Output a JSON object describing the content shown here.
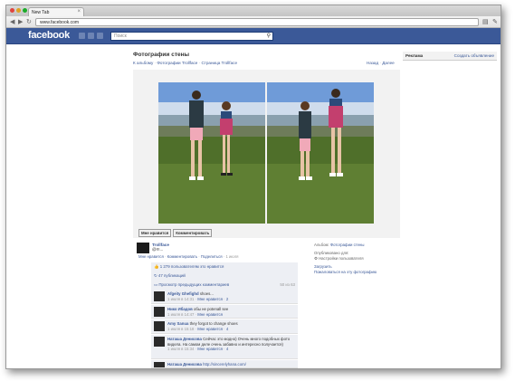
{
  "browser": {
    "tab_title": "New Tab",
    "url": "www.facebook.com"
  },
  "fb": {
    "logo": "facebook",
    "search_placeholder": "Поиск"
  },
  "page": {
    "title": "Фотографии стены",
    "breadcrumbs": [
      "К альбому",
      "Фотографии Trollface",
      "Страница Trollface"
    ],
    "pager_prev": "Назад",
    "pager_next": "Далее"
  },
  "ads": {
    "title": "Реклама",
    "create": "Создать объявление"
  },
  "actions": {
    "like": "Мне нравится",
    "comment": "Комментировать"
  },
  "post": {
    "author": "Trollface",
    "text": "@!!!...",
    "meta_like": "Мне нравится",
    "meta_comment": "Комментировать",
    "meta_share": "Поделиться",
    "meta_time": "1 июля",
    "likes": "1 279 пользователям это нравится",
    "shares": "47 публикаций",
    "prev_comments": "Просмотр предыдущих комментариев",
    "prev_count": "50 из 63"
  },
  "comments": [
    {
      "name": "Afgeity Ghefighd",
      "text": "shoes...",
      "meta": "1 июля в 14:31",
      "like": "Мне нравится",
      "count": "2"
    },
    {
      "name": "Нико Ибадов",
      "text": "обы не potenall see",
      "meta": "1 июля в 14:47",
      "like": "Мне нравится",
      "count": ""
    },
    {
      "name": "Amy Sanua",
      "text": "they forgot to change shoes",
      "meta": "1 июля в 15:18",
      "like": "Мне нравится",
      "count": "4"
    },
    {
      "name": "Наташа Денисова",
      "text": "Сейчас это модно) Очень много подобных фото видела. На самом деле очень забавно и интересно получается)",
      "meta": "1 июля в 15:34",
      "like": "Мне нравится",
      "count": "4"
    },
    {
      "name": "Наташа Денисова",
      "text": "http://sincerelyhana.com/",
      "meta": "",
      "like": "",
      "count": ""
    }
  ],
  "album": {
    "album_label": "Альбом:",
    "album_link": "Фотографии стены",
    "published_label": "Опубликовано для:",
    "privacy": "Настройки пользователя",
    "download": "Загрузить",
    "report": "Пожаловаться на эту фотографию"
  },
  "colors": {
    "fb_blue": "#3b5998",
    "link": "#3b5998",
    "ufi_bg": "#edeff4"
  }
}
